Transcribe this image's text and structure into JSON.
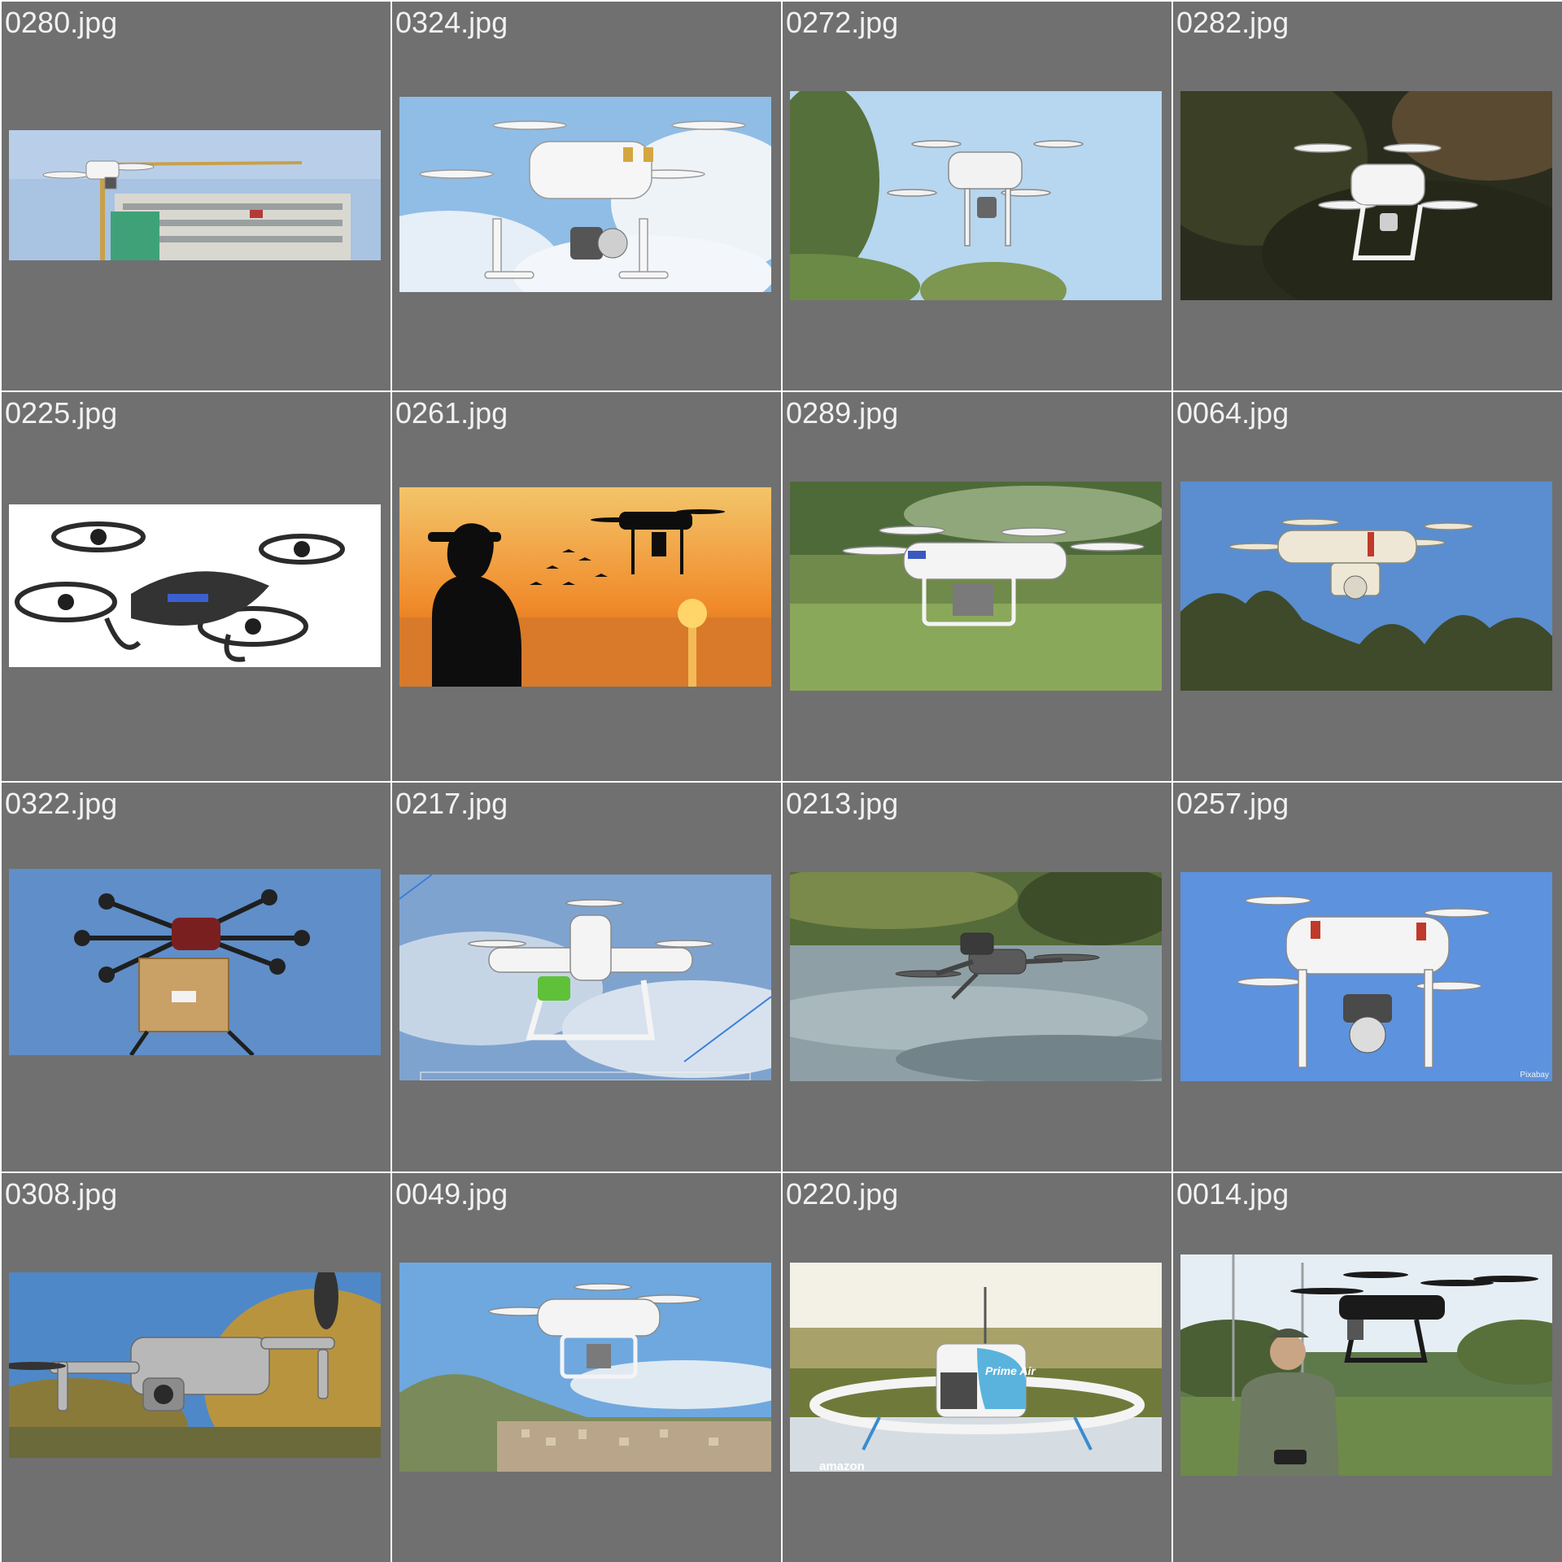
{
  "gallery": {
    "tiles": [
      {
        "filename": "0280.jpg",
        "image": "drone-over-construction-crane"
      },
      {
        "filename": "0324.jpg",
        "image": "white-quadcopter-cloudy-sky"
      },
      {
        "filename": "0272.jpg",
        "image": "quadcopter-above-trees"
      },
      {
        "filename": "0282.jpg",
        "image": "white-drone-dark-forest"
      },
      {
        "filename": "0225.jpg",
        "image": "black-toy-quadcopter-white-background"
      },
      {
        "filename": "0261.jpg",
        "image": "silhouette-pilot-drone-sunset"
      },
      {
        "filename": "0289.jpg",
        "image": "white-drone-over-green-field"
      },
      {
        "filename": "0064.jpg",
        "image": "white-drone-blue-sky-trees"
      },
      {
        "filename": "0322.jpg",
        "image": "hexacopter-carrying-package"
      },
      {
        "filename": "0217.jpg",
        "image": "agricultural-drone-with-sprayer"
      },
      {
        "filename": "0213.jpg",
        "image": "folding-drone-over-river"
      },
      {
        "filename": "0257.jpg",
        "image": "white-quadcopter-blue-sky",
        "watermark": "Pixabay"
      },
      {
        "filename": "0308.jpg",
        "image": "grey-folding-drone-autumn-trees"
      },
      {
        "filename": "0049.jpg",
        "image": "white-quadcopter-over-city"
      },
      {
        "filename": "0220.jpg",
        "image": "prime-air-delivery-drone",
        "logo_text": "Prime Air",
        "brand_text": "amazon"
      },
      {
        "filename": "0014.jpg",
        "image": "soldier-operating-black-drone"
      }
    ]
  },
  "colors": {
    "tile_background": "#707070",
    "filename_text": "#f2f2f2",
    "grid_gap": "#ffffff"
  }
}
